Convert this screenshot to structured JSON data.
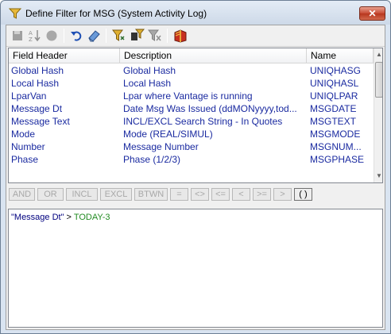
{
  "window": {
    "title": "Define Filter for MSG (System Activity Log)",
    "close_label": "✕"
  },
  "toolbar": {
    "icons": [
      "save-icon",
      "sort-az-icon",
      "record-icon",
      "undo-icon",
      "eraser-icon",
      "filter-icon",
      "filter-apply-icon",
      "filter-clear-icon",
      "book-icon"
    ]
  },
  "grid": {
    "columns": [
      "Field Header",
      "Description",
      "Name"
    ],
    "rows": [
      [
        "Global Hash",
        "Global Hash",
        "UNIQHASG"
      ],
      [
        "Local Hash",
        "Local Hash",
        "UNIQHASL"
      ],
      [
        "LparVan",
        "Lpar where Vantage is running",
        "UNIQLPAR"
      ],
      [
        "Message Dt",
        "Date Msg Was Issued (ddMONyyyy,tod...",
        "MSGDATE"
      ],
      [
        "Message Text",
        "INCL/EXCL Search String - In Quotes",
        "MSGTEXT"
      ],
      [
        "Mode",
        "Mode (REAL/SIMUL)",
        "MSGMODE"
      ],
      [
        "Number",
        "Message Number",
        "MSGNUM..."
      ],
      [
        "Phase",
        "Phase (1/2/3)",
        "MSGPHASE"
      ]
    ]
  },
  "operators": [
    "AND",
    "OR",
    "INCL",
    "EXCL",
    "BTWN",
    "=",
    "<>",
    "<=",
    "<",
    ">=",
    ">",
    "( )"
  ],
  "expression": {
    "field": "\"Message Dt\"",
    "operator": " > ",
    "value": "TODAY-3"
  },
  "colors": {
    "field_text": "#1a2aa0",
    "value_text": "#228b22"
  }
}
